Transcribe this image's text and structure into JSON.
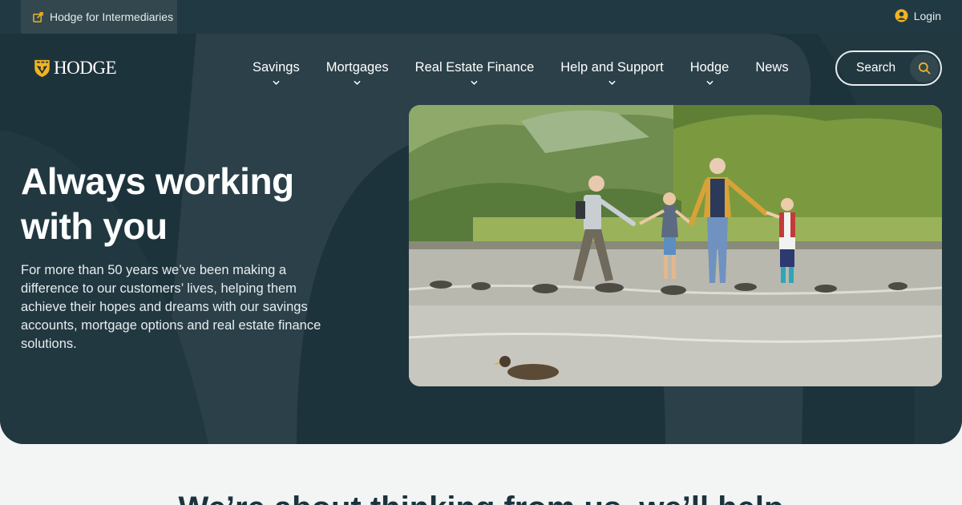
{
  "topbar": {
    "intermediaries_label": "Hodge for Intermediaries",
    "intermediaries_icon": "external-link-icon",
    "login_label": "Login",
    "login_icon": "user-circle-icon"
  },
  "brand": {
    "logo_text": "HODGE",
    "logo_icon": "shield-icon"
  },
  "nav": {
    "items": [
      {
        "label": "Savings",
        "has_dropdown": true
      },
      {
        "label": "Mortgages",
        "has_dropdown": true
      },
      {
        "label": "Real Estate Finance",
        "has_dropdown": true
      },
      {
        "label": "Help and Support",
        "has_dropdown": true
      },
      {
        "label": "Hodge",
        "has_dropdown": true
      },
      {
        "label": "News",
        "has_dropdown": false
      }
    ]
  },
  "search": {
    "label": "Search",
    "icon": "search-icon"
  },
  "hero": {
    "title_line1": "Always working",
    "title_line2": "with you",
    "body": "For more than 50 years we’ve been making a difference to our customers’ lives, helping them achieve their hopes and dreams with our savings accounts, mortgage options and real estate finance solutions."
  },
  "next_section": {
    "heading": "We’re about thinking from us, we’ll help"
  },
  "colors": {
    "topbar": "#213943",
    "hero_bg": "#1d333c",
    "accent_gold": "#f0b323",
    "text_light": "#ffffff",
    "page_bg": "#f3f5f5"
  }
}
